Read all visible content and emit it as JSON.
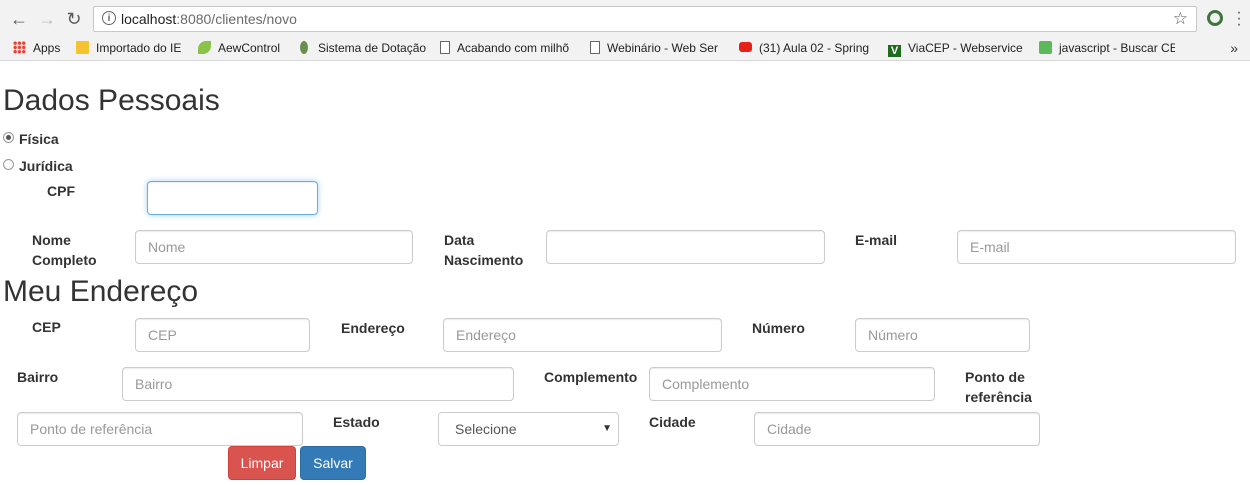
{
  "browser": {
    "url_host": "localhost",
    "url_path": ":8080/clientes/novo",
    "bookmarks": [
      {
        "label": "Apps",
        "icon": "apps-grid-icon"
      },
      {
        "label": "Importado do IE",
        "icon": "folder-icon"
      },
      {
        "label": "AewControl",
        "icon": "leaf-icon"
      },
      {
        "label": "Sistema de Dotação",
        "icon": "dot-icon"
      },
      {
        "label": "Acabando com milhõ",
        "icon": "page-icon"
      },
      {
        "label": "Webinário - Web Ser",
        "icon": "page-icon"
      },
      {
        "label": "(31) Aula 02 - Spring",
        "icon": "youtube-icon"
      },
      {
        "label": "ViaCEP - Webservice",
        "icon": "viacep-icon"
      },
      {
        "label": "javascript - Buscar CE",
        "icon": "stackoverflow-icon"
      }
    ],
    "more": "»"
  },
  "form": {
    "section_personal": "Dados Pessoais",
    "radio_fisica": "Física",
    "radio_juridica": "Jurídica",
    "cpf_label": "CPF",
    "cpf_value": "",
    "nome_label_1": "Nome",
    "nome_label_2": "Completo",
    "nome_placeholder": "Nome",
    "nasc_label_1": "Data",
    "nasc_label_2": "Nascimento",
    "email_label": "E-mail",
    "email_placeholder": "E-mail",
    "section_address": "Meu Endereço",
    "cep_label": "CEP",
    "cep_placeholder": "CEP",
    "endereco_label": "Endereço",
    "endereco_placeholder": "Endereço",
    "numero_label": "Número",
    "numero_placeholder": "Número",
    "bairro_label": "Bairro",
    "bairro_placeholder": "Bairro",
    "complemento_label": "Complemento",
    "complemento_placeholder": "Complemento",
    "ponto_label_1": "Ponto de",
    "ponto_label_2": "referência",
    "ponto_placeholder": "Ponto de referência",
    "estado_label": "Estado",
    "estado_selected": "Selecione",
    "cidade_label": "Cidade",
    "cidade_placeholder": "Cidade",
    "btn_limpar": "Limpar",
    "btn_salvar": "Salvar"
  }
}
